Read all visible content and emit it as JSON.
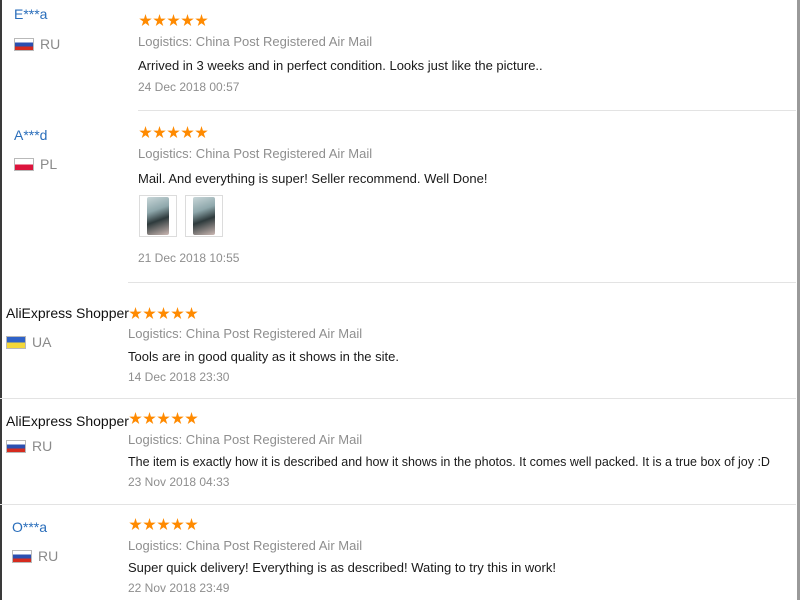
{
  "reviews": [
    {
      "user": "E***a",
      "country": "RU",
      "flag": "ru",
      "rating": 5,
      "logistics": "Logistics: China Post Registered Air Mail",
      "text": "Arrived in 3 weeks and in perfect condition. Looks just like the picture..",
      "date": "24 Dec 2018 00:57"
    },
    {
      "user": "A***d",
      "country": "PL",
      "flag": "pl",
      "rating": 5,
      "logistics": "Logistics: China Post Registered Air Mail",
      "text": "Mail. And everything is super! Seller recommend. Well Done!",
      "photos": 2,
      "date": "21 Dec 2018 10:55"
    },
    {
      "user": "AliExpress Shopper",
      "country": "UA",
      "flag": "ua",
      "rating": 5,
      "logistics": "Logistics: China Post Registered Air Mail",
      "text": "Tools are in good quality as it shows in the site.",
      "date": "14 Dec 2018 23:30"
    },
    {
      "user": "AliExpress Shopper",
      "country": "RU",
      "flag": "ru",
      "rating": 5,
      "logistics": "Logistics: China Post Registered Air Mail",
      "text": "The item is exactly how it is described and how it shows in the photos. It comes well packed. It is a true box of joy :D",
      "date": "23 Nov 2018 04:33"
    },
    {
      "user": "O***a",
      "country": "RU",
      "flag": "ru",
      "rating": 5,
      "logistics": "Logistics: China Post Registered Air Mail",
      "text": "Super quick delivery! Everything is as described! Wating to try this in work!",
      "date": "22 Nov 2018 23:49"
    }
  ],
  "colors": {
    "star": "#ff8a00",
    "username_link": "#2a6ebb",
    "muted_text": "#8e8e8e"
  }
}
